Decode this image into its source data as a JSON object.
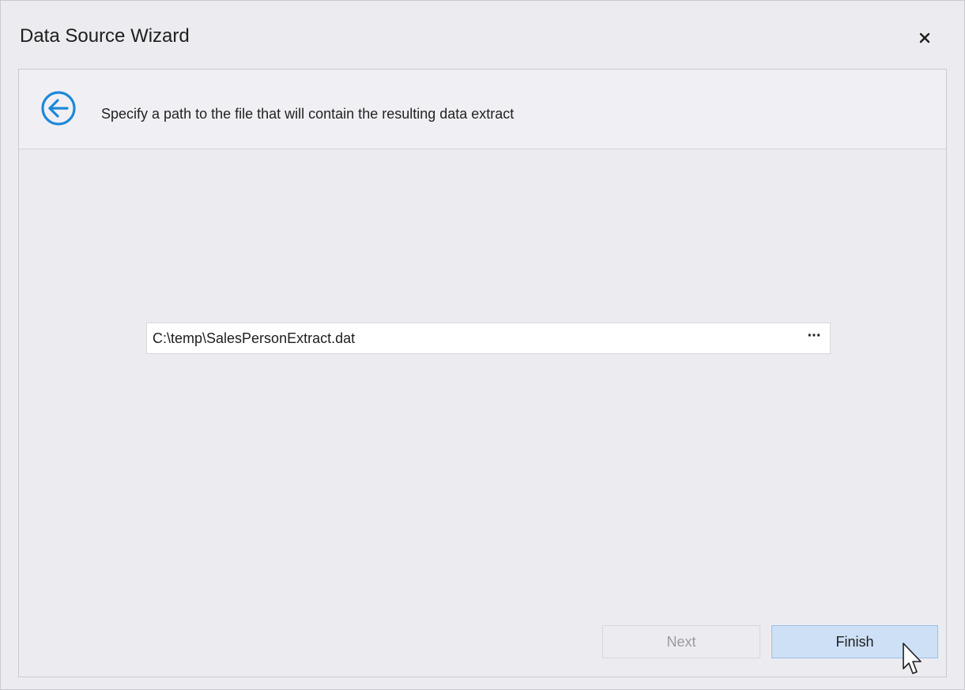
{
  "window": {
    "title": "Data Source Wizard"
  },
  "header": {
    "instruction": "Specify a path to the file that will contain the resulting data extract"
  },
  "path_field": {
    "value": "C:\\temp\\SalesPersonExtract.dat",
    "browse_label": "···"
  },
  "buttons": {
    "next_label": "Next",
    "finish_label": "Finish"
  },
  "icons": {
    "close": "close-icon",
    "back": "back-arrow-icon",
    "cursor": "mouse-pointer-icon"
  },
  "colors": {
    "accent": "#1e88d8",
    "finish_bg": "#cde0f5",
    "finish_border": "#9bbfe4",
    "disabled_text": "#9a9aa0"
  }
}
